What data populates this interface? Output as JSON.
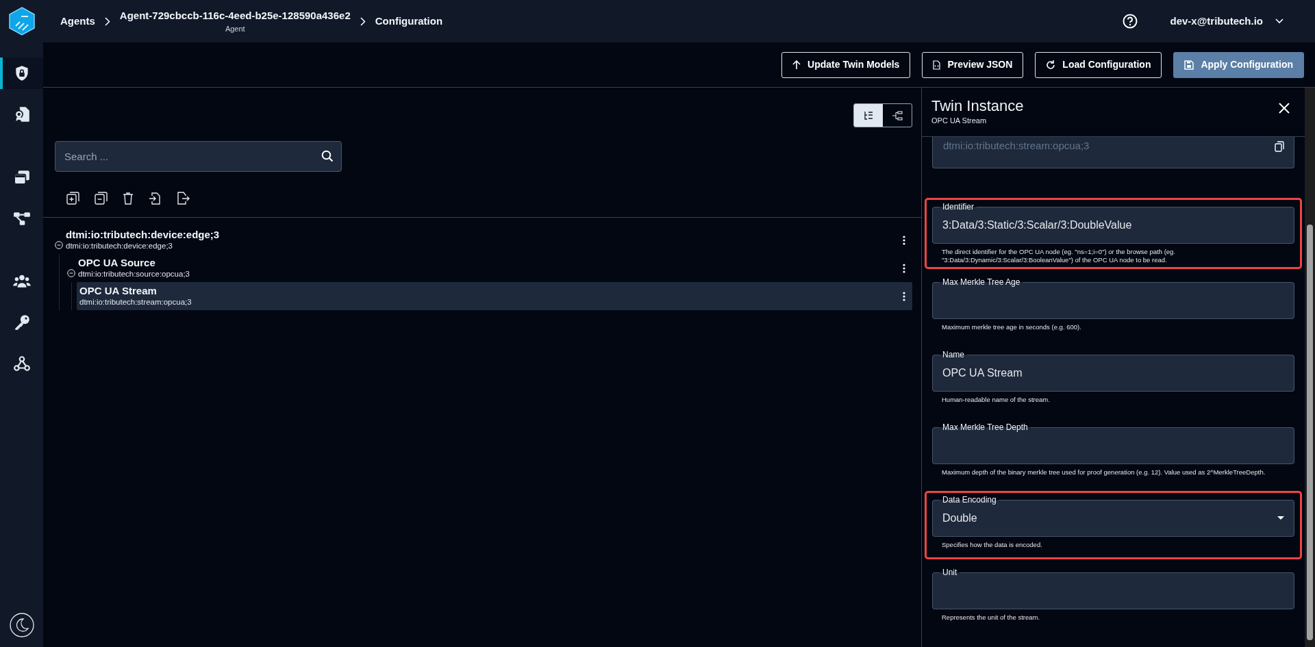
{
  "topbar": {
    "breadcrumbs": [
      {
        "label": "Agents"
      },
      {
        "label": "Agent-729cbccb-116c-4eed-b25e-128590a436e2",
        "subtitle": "Agent"
      },
      {
        "label": "Configuration"
      }
    ],
    "user": "dev-x@tributech.io"
  },
  "sidebar": {
    "items": [
      {
        "selected": true
      },
      {
        "selected": false
      },
      {
        "selected": false
      },
      {
        "selected": false
      },
      {
        "selected": false
      },
      {
        "selected": false
      },
      {
        "selected": false
      }
    ]
  },
  "toolbar": {
    "buttons": [
      {
        "label": "Update Twin Models",
        "kind": "outline"
      },
      {
        "label": "Preview JSON",
        "kind": "outline"
      },
      {
        "label": "Load Configuration",
        "kind": "outline"
      },
      {
        "label": "Apply Configuration",
        "kind": "primary"
      }
    ]
  },
  "view_toggle": [
    {
      "selected": true
    },
    {
      "selected": false
    }
  ],
  "search": {
    "placeholder": "Search ..."
  },
  "tree": [
    {
      "title": "dtmi:io:tributech:device:edge;3",
      "subtitle": "dtmi:io:tributech:device:edge;3",
      "expanded": true,
      "selected": false,
      "children": [
        {
          "title": "OPC UA Source",
          "subtitle": "dtmi:io:tributech:source:opcua;3",
          "expanded": true,
          "selected": false,
          "children": [
            {
              "title": "OPC UA Stream",
              "subtitle": "dtmi:io:tributech:stream:opcua;3",
              "selected": true
            }
          ]
        }
      ]
    }
  ],
  "panel": {
    "title": "Twin Instance",
    "subtitle": "OPC UA Stream",
    "fields": [
      {
        "kind": "readonly",
        "value": "dtmi:io:tributech:stream:opcua;3",
        "highlighted": false
      },
      {
        "kind": "text",
        "label": "Identifier",
        "value": "3:Data/3:Static/3:Scalar/3:DoubleValue",
        "help": "The direct identifier for the OPC UA node (eg. \"ns=1;i=0\") or the browse path (eg. \"3:Data/3:Dynamic/3:Scalar/3:BooleanValue\") of the OPC UA node to be read.",
        "highlighted": true
      },
      {
        "kind": "text",
        "label": "Max Merkle Tree Age",
        "help": "Maximum merkle tree age in seconds (e.g. 600).",
        "highlighted": false
      },
      {
        "kind": "text",
        "label": "Name",
        "value": "OPC UA Stream",
        "help": "Human-readable name of the stream.",
        "highlighted": false
      },
      {
        "kind": "text",
        "label": "Max Merkle Tree Depth",
        "help": "Maximum depth of the binary merkle tree used for proof generation (e.g. 12). Value used as 2^MerkleTreeDepth.",
        "highlighted": false
      },
      {
        "kind": "select",
        "label": "Data Encoding",
        "value": "Double",
        "help": "Specifies how the data is encoded.",
        "highlighted": true
      },
      {
        "kind": "text",
        "label": "Unit",
        "help": "Represents the unit of the stream.",
        "highlighted": false
      }
    ]
  }
}
